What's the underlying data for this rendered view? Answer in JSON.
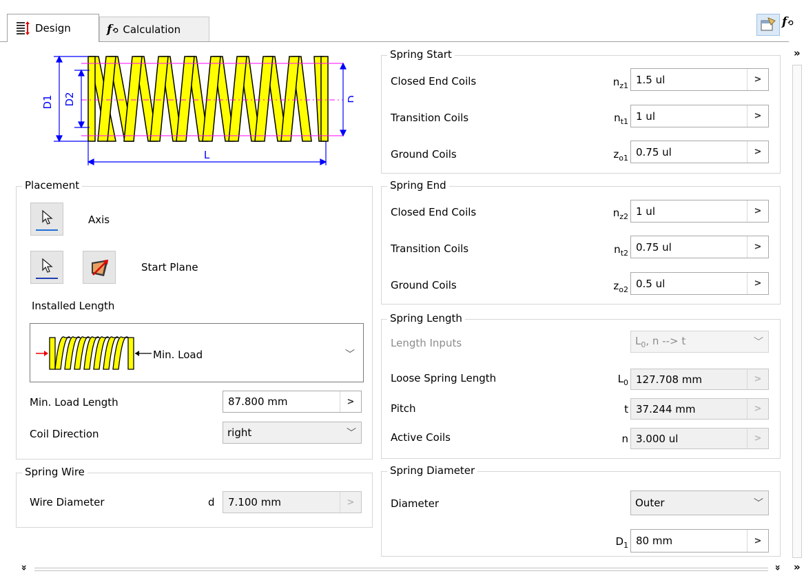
{
  "tabs": {
    "design": "Design",
    "calculation": "Calculation"
  },
  "diagram": {
    "d1": "D1",
    "d2": "D2",
    "d": "D",
    "l": "L"
  },
  "placement": {
    "legend": "Placement",
    "axis": "Axis",
    "start_plane": "Start Plane",
    "installed_length": "Installed Length",
    "installed_option": "Min. Load",
    "min_load_length_label": "Min. Load Length",
    "min_load_length_value": "87.800 mm",
    "coil_direction_label": "Coil Direction",
    "coil_direction_value": "right"
  },
  "spring_wire": {
    "legend": "Spring Wire",
    "wire_diameter_label": "Wire Diameter",
    "wire_diameter_symbol": "d",
    "wire_diameter_value": "7.100 mm"
  },
  "spring_start": {
    "legend": "Spring Start",
    "closed_label": "Closed End Coils",
    "closed_sym": "n",
    "closed_sub": "z1",
    "closed_value": "1.5 ul",
    "transition_label": "Transition Coils",
    "transition_sym": "n",
    "transition_sub": "t1",
    "transition_value": "1 ul",
    "ground_label": "Ground Coils",
    "ground_sym": "z",
    "ground_sub": "o1",
    "ground_value": "0.75 ul"
  },
  "spring_end": {
    "legend": "Spring End",
    "closed_label": "Closed End Coils",
    "closed_sym": "n",
    "closed_sub": "z2",
    "closed_value": "1 ul",
    "transition_label": "Transition Coils",
    "transition_sym": "n",
    "transition_sub": "t2",
    "transition_value": "0.75 ul",
    "ground_label": "Ground Coils",
    "ground_sym": "z",
    "ground_sub": "o2",
    "ground_value": "0.5 ul"
  },
  "spring_length": {
    "legend": "Spring Length",
    "length_inputs_label": "Length Inputs",
    "length_inputs_pre": "L",
    "length_inputs_sub": "0",
    "length_inputs_post": ", n --> t",
    "loose_label": "Loose Spring Length",
    "loose_sym": "L",
    "loose_sub": "0",
    "loose_value": "127.708 mm",
    "pitch_label": "Pitch",
    "pitch_sym": "t",
    "pitch_value": "37.244 mm",
    "active_label": "Active Coils",
    "active_sym": "n",
    "active_value": "3.000 ul"
  },
  "spring_diameter": {
    "legend": "Spring Diameter",
    "diameter_label": "Diameter",
    "diameter_option": "Outer",
    "d1_sym": "D",
    "d1_sub": "1",
    "d1_value": "80 mm"
  },
  "icons": {
    "spring_icon": "spring-icon",
    "fx_icon": "fx-icon",
    "pick_icon": "cursor-pick-icon",
    "flip_icon": "flip-icon"
  },
  "colors": {
    "spring_fill": "#ffff00",
    "arrow_blue": "#1e6fd6",
    "dimension_blue": "#0000ff",
    "center_magenta": "#ff00ff"
  }
}
